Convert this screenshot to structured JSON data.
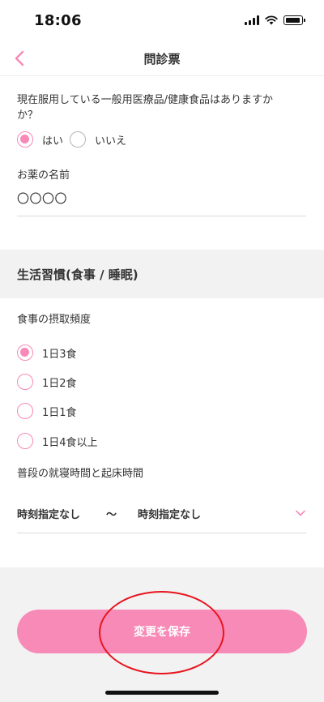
{
  "status_bar": {
    "time": "18:06"
  },
  "nav": {
    "title": "問診票"
  },
  "otc_question": {
    "text_line1": "現在服用している一般用医療品/健康食品はありますか",
    "text_line2": "か？",
    "options": [
      {
        "label": "はい",
        "checked": true
      },
      {
        "label": "いいえ",
        "checked": false
      }
    ]
  },
  "medicine_name": {
    "label": "お薬の名前",
    "value": "〇〇〇〇"
  },
  "lifestyle_section": {
    "title": "生活習慣(食事 / 睡眠)"
  },
  "meal_frequency": {
    "label": "食事の摂取頻度",
    "options": [
      {
        "label": "1日3食",
        "checked": true
      },
      {
        "label": "1日2食",
        "checked": false
      },
      {
        "label": "1日1食",
        "checked": false
      },
      {
        "label": "1日4食以上",
        "checked": false
      }
    ]
  },
  "sleep_time": {
    "label": "普段の就寝時間と起床時間",
    "bedtime": "時刻指定なし",
    "separator": "〜",
    "wake_time": "時刻指定なし"
  },
  "footer": {
    "save_label": "変更を保存"
  },
  "colors": {
    "accent": "#f78ab7",
    "annotation": "#e8141e",
    "section_bg": "#f2f2f2"
  },
  "icons": {
    "back": "chevron-left-icon",
    "dropdown": "chevron-down-icon"
  }
}
